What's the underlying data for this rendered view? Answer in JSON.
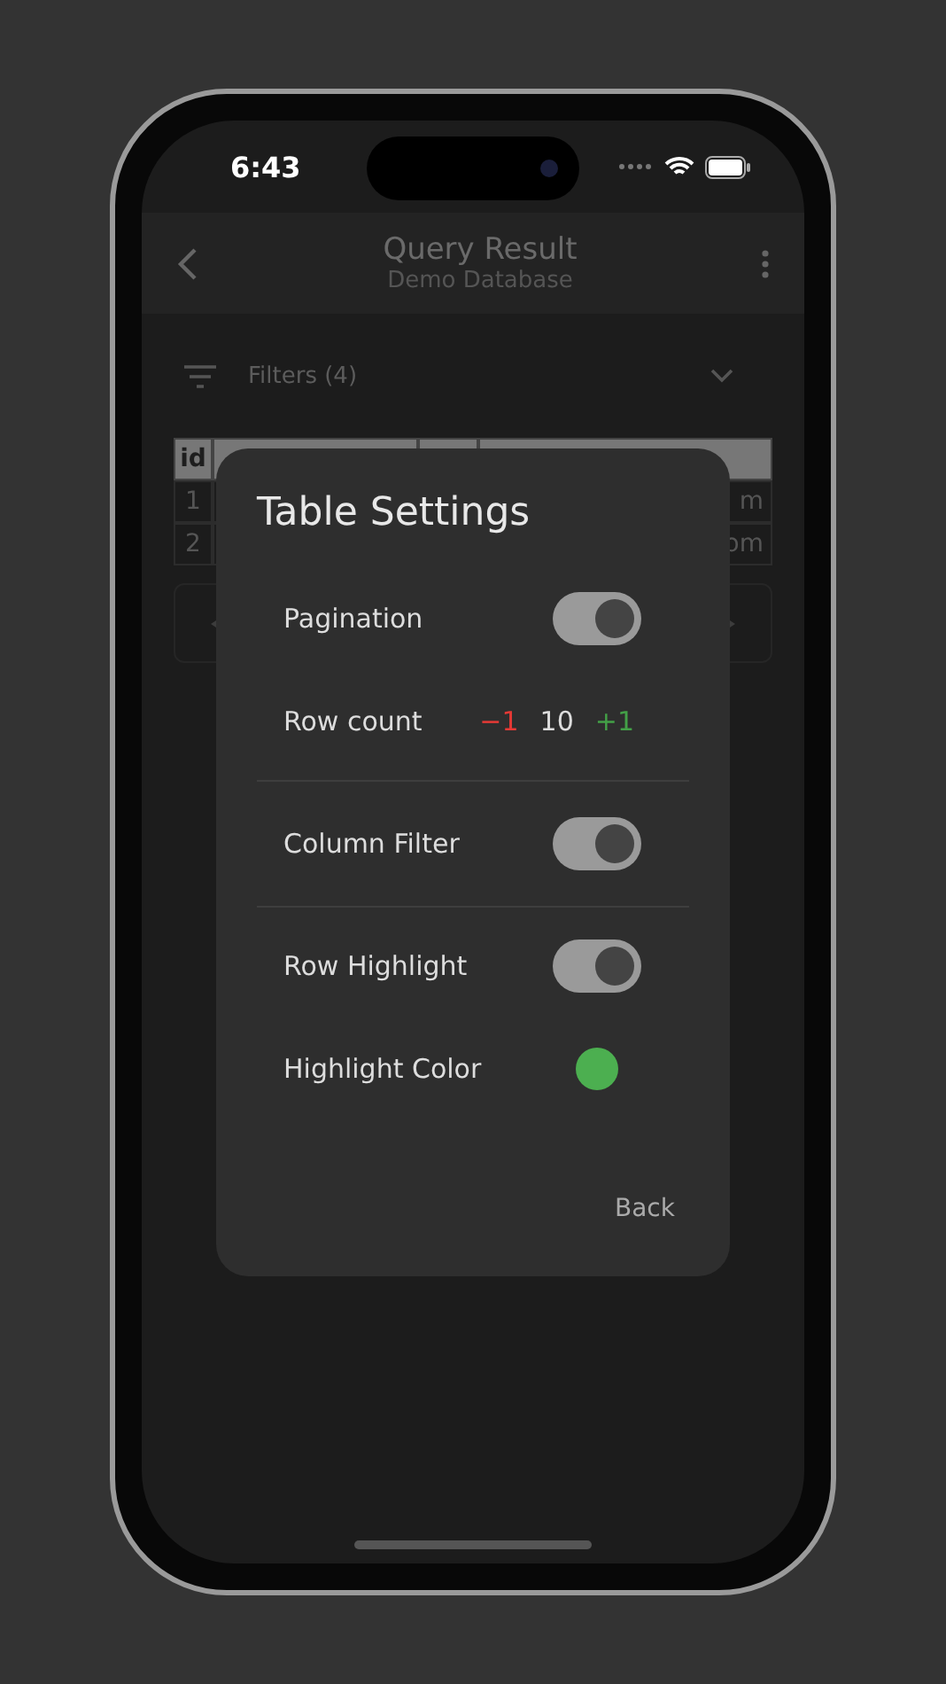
{
  "status_bar": {
    "time": "6:43"
  },
  "app_bar": {
    "title": "Query Result",
    "subtitle": "Demo Database"
  },
  "filters": {
    "label": "Filters (4)",
    "expanded": false
  },
  "table": {
    "header": "id",
    "rows": [
      {
        "id": "1",
        "column_4": "m"
      },
      {
        "id": "2",
        "column_4": "om"
      }
    ]
  },
  "dialog": {
    "title": "Table Settings",
    "sections": [
      [
        {
          "kind": "toggle",
          "label": "Pagination",
          "on": true
        },
        {
          "kind": "stepper",
          "label": "Row count",
          "decrement": "−1",
          "value": "10",
          "increment": "+1"
        }
      ],
      [
        {
          "kind": "toggle",
          "label": "Column Filter",
          "on": true
        }
      ],
      [
        {
          "kind": "toggle",
          "label": "Row Highlight",
          "on": true
        },
        {
          "kind": "color",
          "label": "Highlight Color",
          "color": "#4caf50"
        }
      ]
    ],
    "back_button": "Back"
  }
}
